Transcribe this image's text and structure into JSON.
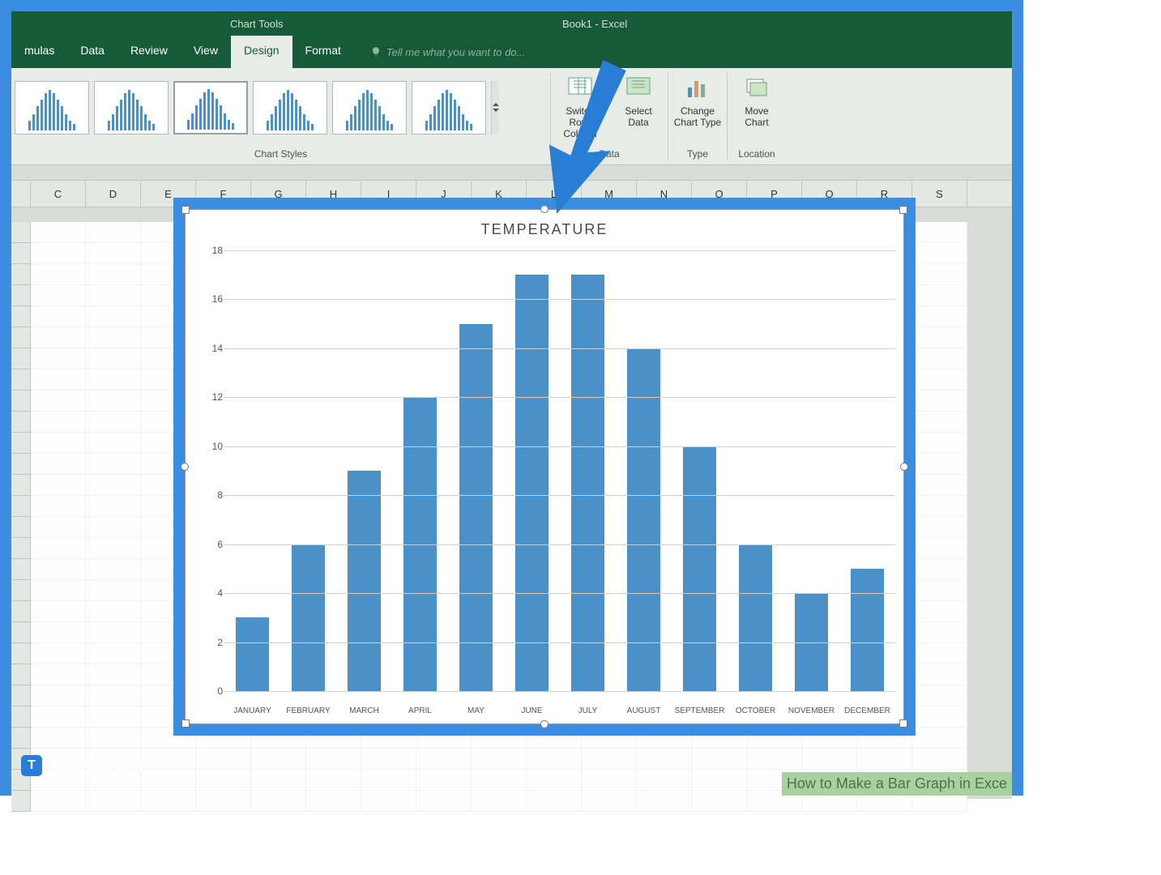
{
  "window": {
    "chart_tools": "Chart Tools",
    "title": "Book1 - Excel"
  },
  "tabs": {
    "formulas": "mulas",
    "data": "Data",
    "review": "Review",
    "view": "View",
    "design": "Design",
    "format": "Format"
  },
  "tell_me": "Tell me what you want to do...",
  "ribbon": {
    "styles_label": "Chart Styles",
    "switch": "Switch Row/\nColumn",
    "select": "Select\nData",
    "data_label": "Data",
    "change": "Change\nChart Type",
    "type_label": "Type",
    "move": "Move\nChart",
    "location_label": "Location"
  },
  "columns": [
    "C",
    "D",
    "E",
    "F",
    "G",
    "H",
    "I",
    "J",
    "K",
    "L",
    "M",
    "N",
    "O",
    "P",
    "Q",
    "R",
    "S"
  ],
  "chart_data": {
    "type": "bar",
    "title": "TEMPERATURE",
    "categories": [
      "JANUARY",
      "FEBRUARY",
      "MARCH",
      "APRIL",
      "MAY",
      "JUNE",
      "JULY",
      "AUGUST",
      "SEPTEMBER",
      "OCTOBER",
      "NOVEMBER",
      "DECEMBER"
    ],
    "values": [
      3,
      6,
      9,
      12,
      15,
      17,
      17,
      14,
      10,
      6,
      4,
      5
    ],
    "ylim": [
      0,
      18
    ],
    "yticks": [
      0,
      2,
      4,
      6,
      8,
      10,
      12,
      14,
      16,
      18
    ],
    "xlabel": "",
    "ylabel": ""
  },
  "watermark": {
    "brand": "TEMPLATE",
    "suffix": ".NET"
  },
  "wiki": "How to Make a Bar Graph in Exce"
}
